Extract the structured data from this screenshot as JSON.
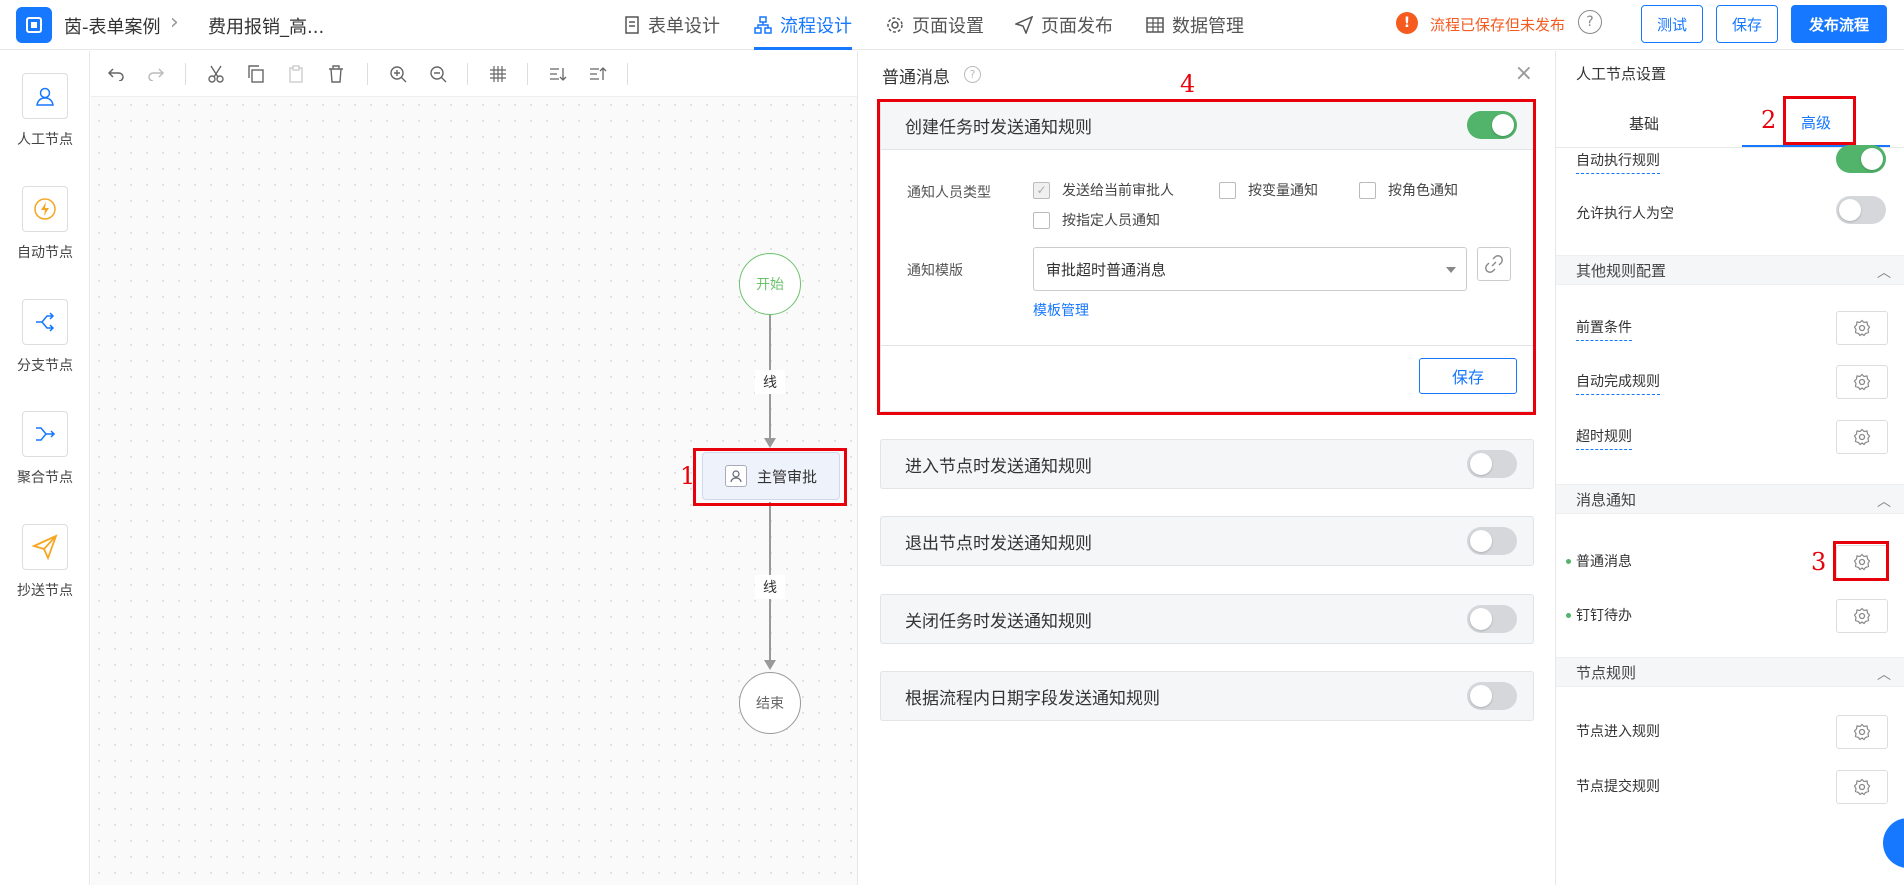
{
  "header": {
    "breadcrumb": [
      "茵-表单案例",
      "费用报销_高..."
    ],
    "tabs": [
      {
        "label": "表单设计",
        "icon": "document-icon"
      },
      {
        "label": "流程设计",
        "icon": "flow-icon"
      },
      {
        "label": "页面设置",
        "icon": "gear-icon"
      },
      {
        "label": "页面发布",
        "icon": "send-icon"
      },
      {
        "label": "数据管理",
        "icon": "table-icon"
      }
    ],
    "active_tab": "流程设计",
    "status": "流程已保存但未发布",
    "buttons": {
      "test": "测试",
      "save": "保存",
      "publish": "发布流程"
    }
  },
  "palette": [
    {
      "label": "人工节点",
      "icon": "user-icon"
    },
    {
      "label": "自动节点",
      "icon": "lightning-icon"
    },
    {
      "label": "分支节点",
      "icon": "branch-icon"
    },
    {
      "label": "聚合节点",
      "icon": "merge-icon"
    },
    {
      "label": "抄送节点",
      "icon": "paper-plane-icon"
    }
  ],
  "flow": {
    "start": "开始",
    "end": "结束",
    "line1": "线",
    "line2": "线",
    "task": "主管审批"
  },
  "drawer": {
    "title": "普通消息",
    "panels": [
      {
        "title": "创建任务时发送通知规则",
        "enabled": true
      },
      {
        "title": "进入节点时发送通知规则",
        "enabled": false
      },
      {
        "title": "退出节点时发送通知规则",
        "enabled": false
      },
      {
        "title": "关闭任务时发送通知规则",
        "enabled": false
      },
      {
        "title": "根据流程内日期字段发送通知规则",
        "enabled": false
      }
    ],
    "notify_type_label": "通知人员类型",
    "options": [
      {
        "label": "发送给当前审批人",
        "checked": true
      },
      {
        "label": "按变量通知",
        "checked": false
      },
      {
        "label": "按角色通知",
        "checked": false
      },
      {
        "label": "按指定人员通知",
        "checked": false
      }
    ],
    "template_label": "通知模版",
    "template_value": "审批超时普通消息",
    "template_link": "模板管理",
    "save": "保存"
  },
  "right": {
    "title": "人工节点设置",
    "tabs": [
      "基础",
      "高级"
    ],
    "active_tab": "高级",
    "toggles": [
      {
        "label": "自动执行规则",
        "enabled": true
      },
      {
        "label": "允许执行人为空",
        "enabled": false
      }
    ],
    "sections": [
      {
        "title": "其他规则配置",
        "items": [
          "前置条件",
          "自动完成规则",
          "超时规则"
        ]
      },
      {
        "title": "消息通知",
        "items": [
          "普通消息",
          "钉钉待办"
        ]
      },
      {
        "title": "节点规则",
        "items": [
          "节点进入规则",
          "节点提交规则"
        ]
      }
    ]
  },
  "annotations": [
    "1",
    "2",
    "3",
    "4"
  ],
  "colors": {
    "accent": "#1677ff",
    "annotation": "#e8000b",
    "toggle_on": "#52b36b",
    "warning": "#f55a1f"
  }
}
